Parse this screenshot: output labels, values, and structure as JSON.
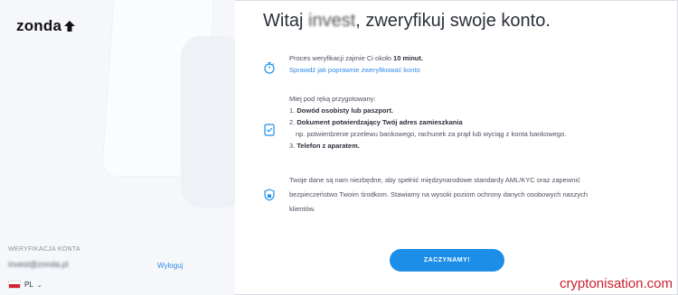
{
  "brand": {
    "logo_text": "zonda"
  },
  "header": {
    "title_prefix": "Witaj ",
    "title_name": "invest",
    "title_suffix": ", zweryfikuj swoje konto."
  },
  "info": {
    "time_text_prefix": "Proces weryfikacji zajmie Ci około ",
    "time_bold": "10 minut.",
    "help_link": "Sprawdź jak poprawnie zweryfikować konto"
  },
  "checklist": {
    "intro": "Miej pod ręką przygotowany:",
    "items": [
      {
        "num": "1.",
        "bold": "Dowód osobisty lub paszport."
      },
      {
        "num": "2.",
        "bold": "Dokument potwierdzający Twój adres zamieszkania"
      },
      {
        "num": "3.",
        "bold": "Telefon z aparatem."
      }
    ],
    "item2_note": "np. potwierdzenie przelewu bankowego, rachunek za prąd lub wyciąg z konta bankowego."
  },
  "security": {
    "text": "Twoje dane są nam niezbędne, aby spełnić międzynarodowe standardy AML/KYC oraz zapewnić bezpieczeństwo Twoim środkom. Stawiamy na wysoki poziom ochrony danych osobowych naszych klientów."
  },
  "cta": {
    "label": "ZACZYNAMY!"
  },
  "account": {
    "label": "WERYFIKACJA KONTA",
    "email": "invest@zonda.pl",
    "logout": "Wyloguj"
  },
  "language": {
    "code": "PL"
  },
  "watermark": "cryptonisation.com",
  "colors": {
    "accent": "#1c8ee8",
    "link": "#2f8ae6",
    "watermark": "#cc1f2d"
  }
}
